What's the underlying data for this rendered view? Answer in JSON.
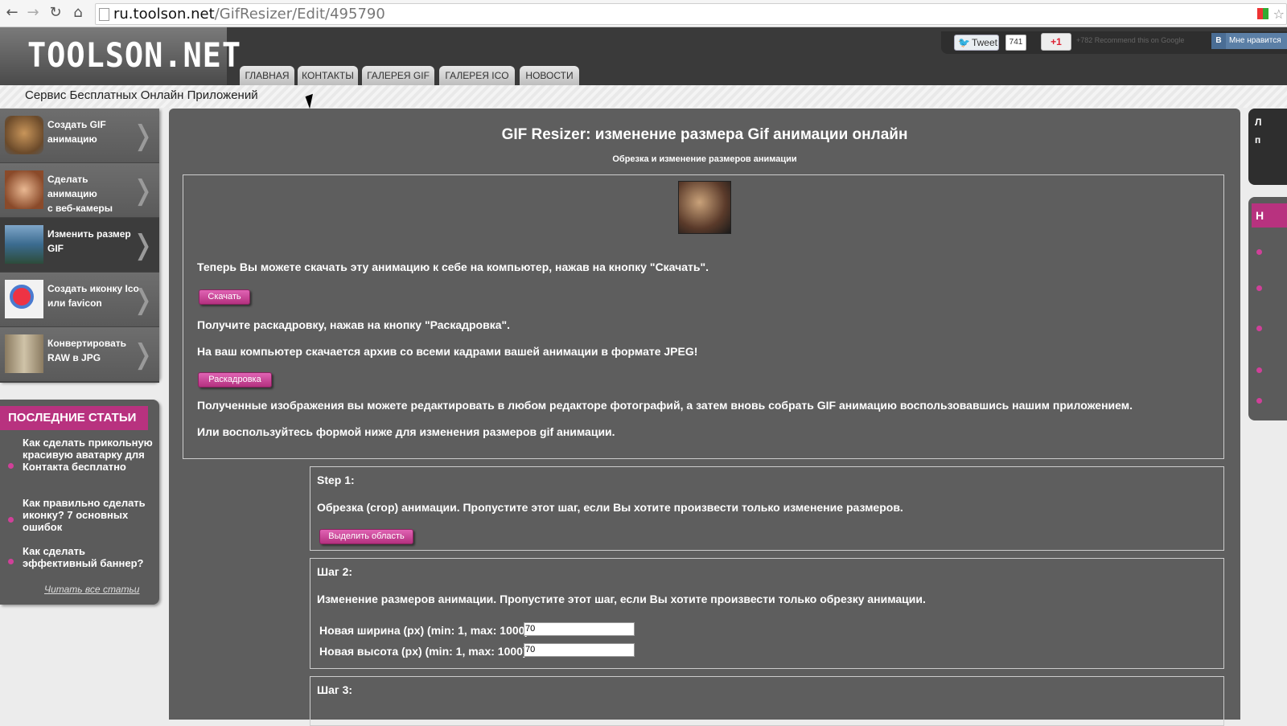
{
  "browser": {
    "back_icon": "arrow-left-icon",
    "url_host": "ru.toolson.net",
    "url_path": "/GifResizer/Edit/495790"
  },
  "header": {
    "logo": "TOOLSON.NET",
    "tabs": [
      "ГЛАВНАЯ",
      "КОНТАКТЫ",
      "ГАЛЕРЕЯ GIF",
      "ГАЛЕРЕЯ ICO",
      "НОВОСТИ"
    ],
    "tweet_label": "Tweet",
    "tweet_count": "741",
    "gplus_label": "+1",
    "gplus_text": "+782 Recommend this on Google",
    "vk_label": "Мне нравится",
    "vk_letter": "В"
  },
  "subheader": "Сервис Бесплатных Онлайн Приложений",
  "sidebar": {
    "items": [
      {
        "line1": "Создать GIF",
        "line2": "анимацию"
      },
      {
        "line1": "Сделать анимацию",
        "line2": "с веб-камеры"
      },
      {
        "line1": "Изменить размер",
        "line2": "GIF"
      },
      {
        "line1": "Создать иконку Ico",
        "line2": "или favicon"
      },
      {
        "line1": "Конвертировать",
        "line2": "RAW в JPG"
      }
    ],
    "articles_title": "ПОСЛЕДНИЕ СТАТЬИ",
    "articles": [
      "Как сделать прикольную красивую аватарку для Контакта бесплатно",
      "Как правильно сделать иконку? 7 основных ошибок",
      "Как сделать эффективный баннер?"
    ],
    "read_all": "Читать все статьи"
  },
  "main": {
    "title": "GIF Resizer: изменение размера Gif анимации онлайн",
    "subtitle": "Обрезка и изменение размеров анимации",
    "download_text": "Теперь Вы можете скачать эту анимацию к себе на компьютер, нажав на кнопку \"Скачать\".",
    "download_button": "Скачать",
    "storyboard_text1": "Получите раскадровку, нажав на кнопку \"Раскадровка\".",
    "storyboard_text2": "На ваш компьютер скачается архив со всеми кадрами вашей анимации в формате JPEG!",
    "storyboard_button": "Раскадровка",
    "edit_text": "Полученные изображения вы можете редактировать в любом редакторе фотографий, а затем вновь собрать GIF анимацию воспользовавшись нашим приложением.",
    "form_text": "Или воспользуйтесь формой ниже для изменения размеров gif анимации.",
    "step1_title": "Step 1:",
    "step1_text": "Обрезка (crop) анимации. Пропустите этот шаг, если Вы хотите произвести только изменение размеров.",
    "step1_button": "Выделить область",
    "step2_title": "Шаг 2:",
    "step2_text": "Изменение размеров анимации. Пропустите этот шаг, если Вы хотите произвести только обрезку анимации.",
    "width_label": "Новая ширина (px) (min: 1, max: 1000)",
    "width_value": "70",
    "height_label": "Новая высота (px) (min: 1, max: 1000)",
    "height_value": "70",
    "step3_title": "Шаг 3:"
  },
  "right": {
    "top_lines": [
      "Л",
      "п"
    ],
    "panel_letter": "Н"
  },
  "colors": {
    "accent": "#b8327f",
    "main_bg": "#5e5e5e",
    "header_bg": "#3a3a3a"
  }
}
